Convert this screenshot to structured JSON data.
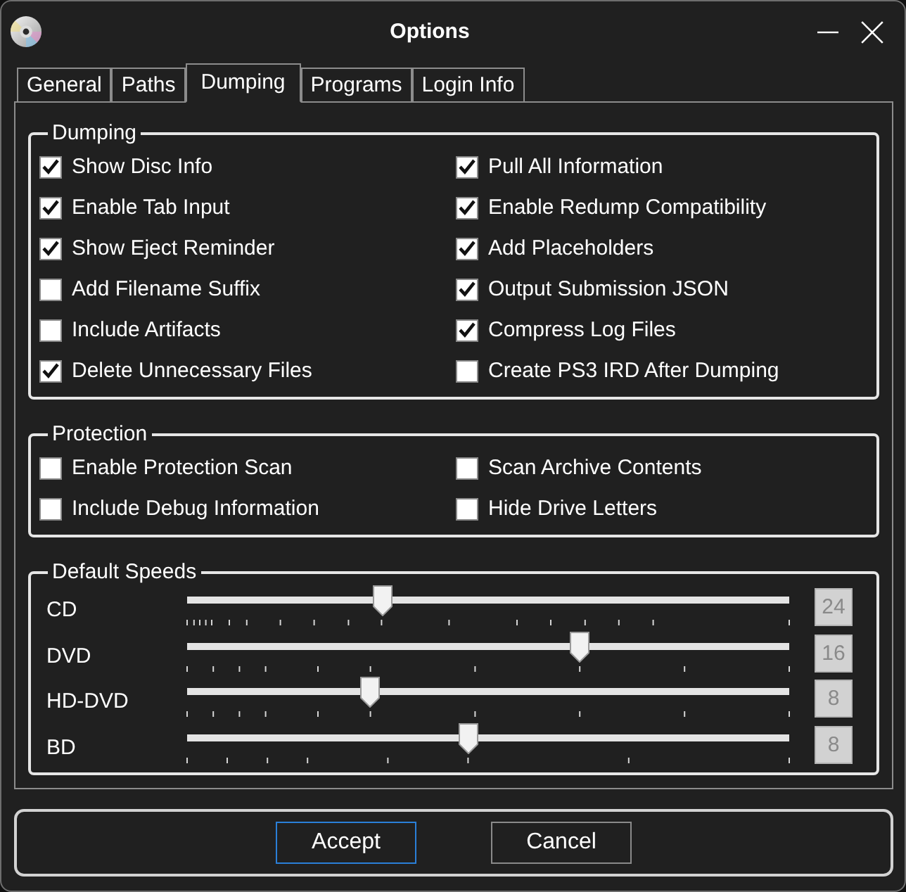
{
  "window": {
    "title": "Options"
  },
  "tabs": [
    {
      "label": "General",
      "selected": false
    },
    {
      "label": "Paths",
      "selected": false
    },
    {
      "label": "Dumping",
      "selected": true
    },
    {
      "label": "Programs",
      "selected": false
    },
    {
      "label": "Login Info",
      "selected": false
    }
  ],
  "groups": [
    {
      "kind": "checkboxes",
      "title": "Dumping",
      "columns": [
        [
          {
            "label": "Show Disc Info",
            "checked": true
          },
          {
            "label": "Enable Tab Input",
            "checked": true
          },
          {
            "label": "Show Eject Reminder",
            "checked": true
          },
          {
            "label": "Add Filename Suffix",
            "checked": false
          },
          {
            "label": "Include Artifacts",
            "checked": false
          },
          {
            "label": "Delete Unnecessary Files",
            "checked": true
          }
        ],
        [
          {
            "label": "Pull All Information",
            "checked": true
          },
          {
            "label": "Enable Redump Compatibility",
            "checked": true
          },
          {
            "label": "Add Placeholders",
            "checked": true
          },
          {
            "label": "Output Submission JSON",
            "checked": true
          },
          {
            "label": "Compress Log Files",
            "checked": true
          },
          {
            "label": "Create PS3 IRD After Dumping",
            "checked": false
          }
        ]
      ]
    },
    {
      "kind": "checkboxes",
      "title": "Protection",
      "columns": [
        [
          {
            "label": "Enable Protection Scan",
            "checked": false
          },
          {
            "label": "Include Debug Information",
            "checked": false
          }
        ],
        [
          {
            "label": "Scan Archive Contents",
            "checked": false
          },
          {
            "label": "Hide Drive Letters",
            "checked": false
          }
        ]
      ]
    },
    {
      "kind": "sliders",
      "title": "Default Speeds",
      "sliders": [
        {
          "label": "CD",
          "level": 0.324,
          "value": "24",
          "disabled": true
        },
        {
          "label": "DVD",
          "level": 0.652,
          "value": "16",
          "disabled": true
        },
        {
          "label": "HD-DVD",
          "level": 0.304,
          "value": "8",
          "disabled": true
        },
        {
          "label": "BD",
          "level": 0.467,
          "value": "8",
          "disabled": true
        }
      ]
    }
  ],
  "buttons": [
    {
      "label": "Accept",
      "focused": true
    },
    {
      "label": "Cancel",
      "focused": false
    }
  ]
}
